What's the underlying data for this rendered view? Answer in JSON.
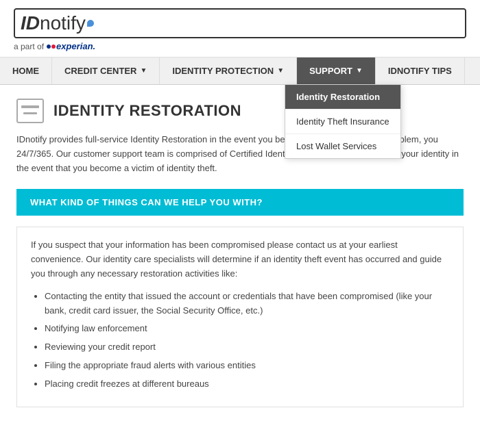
{
  "header": {
    "logo_id": "ID",
    "logo_notify": "notify",
    "tagline_prefix": "a part of",
    "experian_text": "experian."
  },
  "nav": {
    "items": [
      {
        "label": "HOME",
        "has_arrow": false,
        "active": false
      },
      {
        "label": "CREDIT CENTER",
        "has_arrow": true,
        "active": false
      },
      {
        "label": "IDENTITY PROTECTION",
        "has_arrow": true,
        "active": false
      },
      {
        "label": "SUPPORT",
        "has_arrow": true,
        "active": true
      },
      {
        "label": "IDNOTIFY TIPS",
        "has_arrow": false,
        "active": false
      }
    ]
  },
  "dropdown": {
    "items": [
      {
        "label": "Identity Restoration",
        "selected": true
      },
      {
        "label": "Identity Theft Insurance",
        "selected": false
      },
      {
        "label": "Lost Wallet Services",
        "selected": false
      }
    ]
  },
  "page": {
    "title": "IDENTITY RESTORATION",
    "intro": "IDnotify provides full-service Identity Restoration in the event you become a vi... ect there is a problem, you 24/7/365. Our customer support team is comprised of Certified Identity T... ts ready to help you ar your identity in the event that you become a victim of identity theft.",
    "teal_heading": "WHAT KIND OF THINGS CAN WE HELP YOU WITH?",
    "content_text": "If you suspect that your information has been compromised please contact us at your earliest convenience. Our identity care specialists will determine if an identity theft event has occurred and guide you through any necessary restoration activities like:",
    "bullets": [
      "Contacting the entity that issued the account or credentials that have been compromised (like your bank, credit card issuer, the Social Security Office, etc.)",
      "Notifying law enforcement",
      "Reviewing your credit report",
      "Filing the appropriate fraud alerts with various entities",
      "Placing credit freezes at different bureaus"
    ]
  }
}
